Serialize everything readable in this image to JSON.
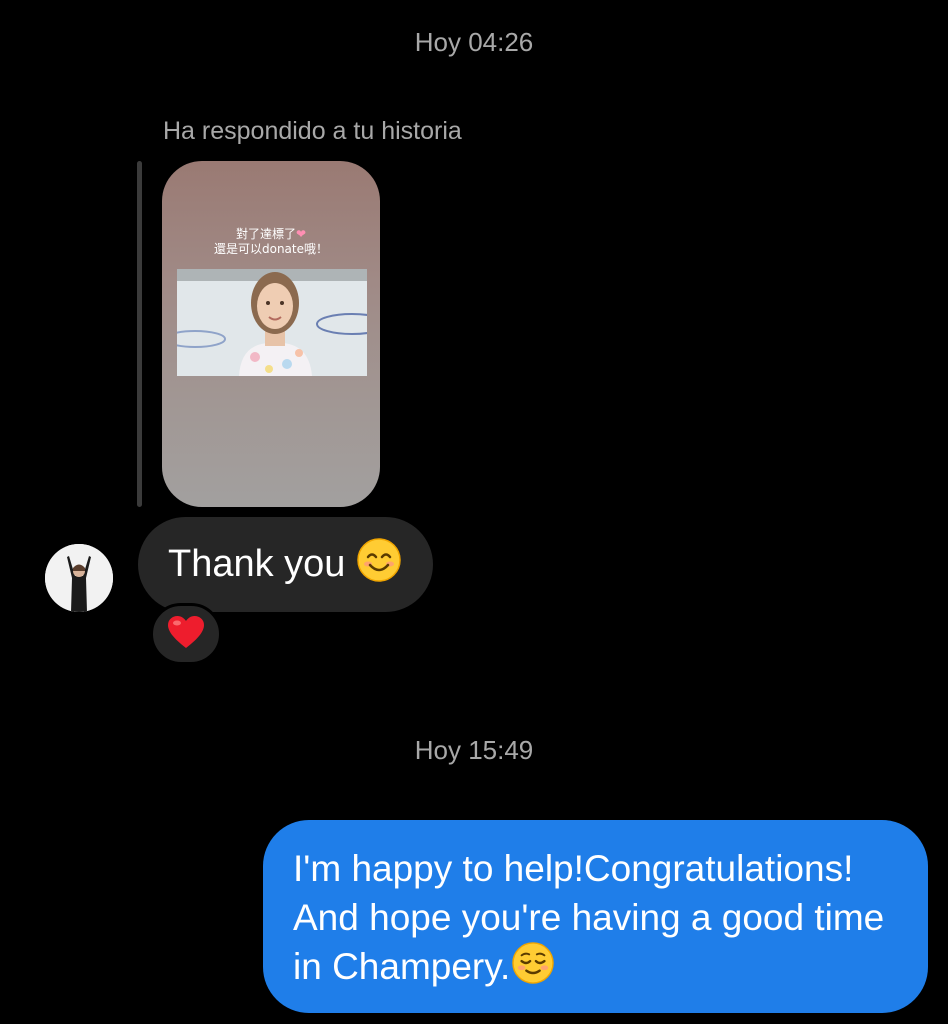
{
  "thread": {
    "timestamp_1": "Hoy 04:26",
    "timestamp_2": "Hoy 15:49"
  },
  "story_reply": {
    "label": "Ha respondido a tu historia",
    "story_caption_line1": "對了達標了",
    "story_caption_line2": "還是可以donate哦！"
  },
  "incoming": {
    "text": "Thank you",
    "emoji": "smiling-face-icon",
    "reaction": "heart-icon"
  },
  "outgoing": {
    "text": "I'm happy to help!Congratulations! And hope you're having a good time in Champery."
  },
  "colors": {
    "background": "#000000",
    "incoming_bubble": "#262626",
    "outgoing_bubble": "#1f7ee9",
    "timestamp": "#a8a8a8"
  }
}
